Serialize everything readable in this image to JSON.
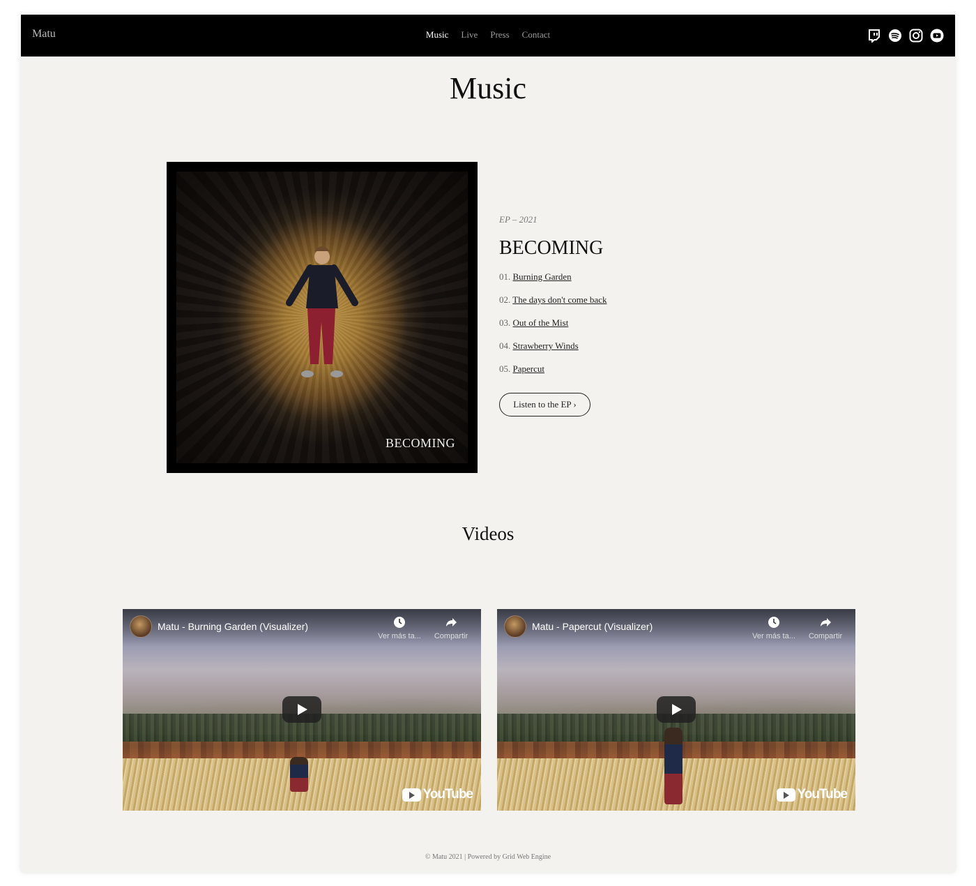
{
  "nav": {
    "brand": "Matu",
    "items": [
      {
        "label": "Music",
        "active": true
      },
      {
        "label": "Live",
        "active": false
      },
      {
        "label": "Press",
        "active": false
      },
      {
        "label": "Contact",
        "active": false
      }
    ],
    "socials": [
      "twitch-icon",
      "spotify-icon",
      "instagram-icon",
      "youtube-icon"
    ]
  },
  "page_title": "Music",
  "release": {
    "cover_title": "BECOMING",
    "meta": "EP – 2021",
    "title": "BECOMING",
    "tracks": [
      {
        "num": "01.",
        "name": "Burning Garden"
      },
      {
        "num": "02.",
        "name": "The days don't come back"
      },
      {
        "num": "03.",
        "name": "Out of the Mist"
      },
      {
        "num": "04.",
        "name": "Strawberry Winds"
      },
      {
        "num": "05.",
        "name": "Papercut"
      }
    ],
    "listen_label": "Listen to the EP ›"
  },
  "videos_title": "Videos",
  "videos": [
    {
      "title": "Matu - Burning Garden (Visualizer)",
      "later_label": "Ver más ta...",
      "share_label": "Compartir",
      "brand": "YouTube"
    },
    {
      "title": "Matu - Papercut (Visualizer)",
      "later_label": "Ver más ta...",
      "share_label": "Compartir",
      "brand": "YouTube"
    }
  ],
  "footer": "© Matu 2021 | Powered by Grid Web Engine",
  "colors": {
    "nav_bg": "#000000",
    "page_bg": "#f3f2ef",
    "text": "#111111"
  }
}
